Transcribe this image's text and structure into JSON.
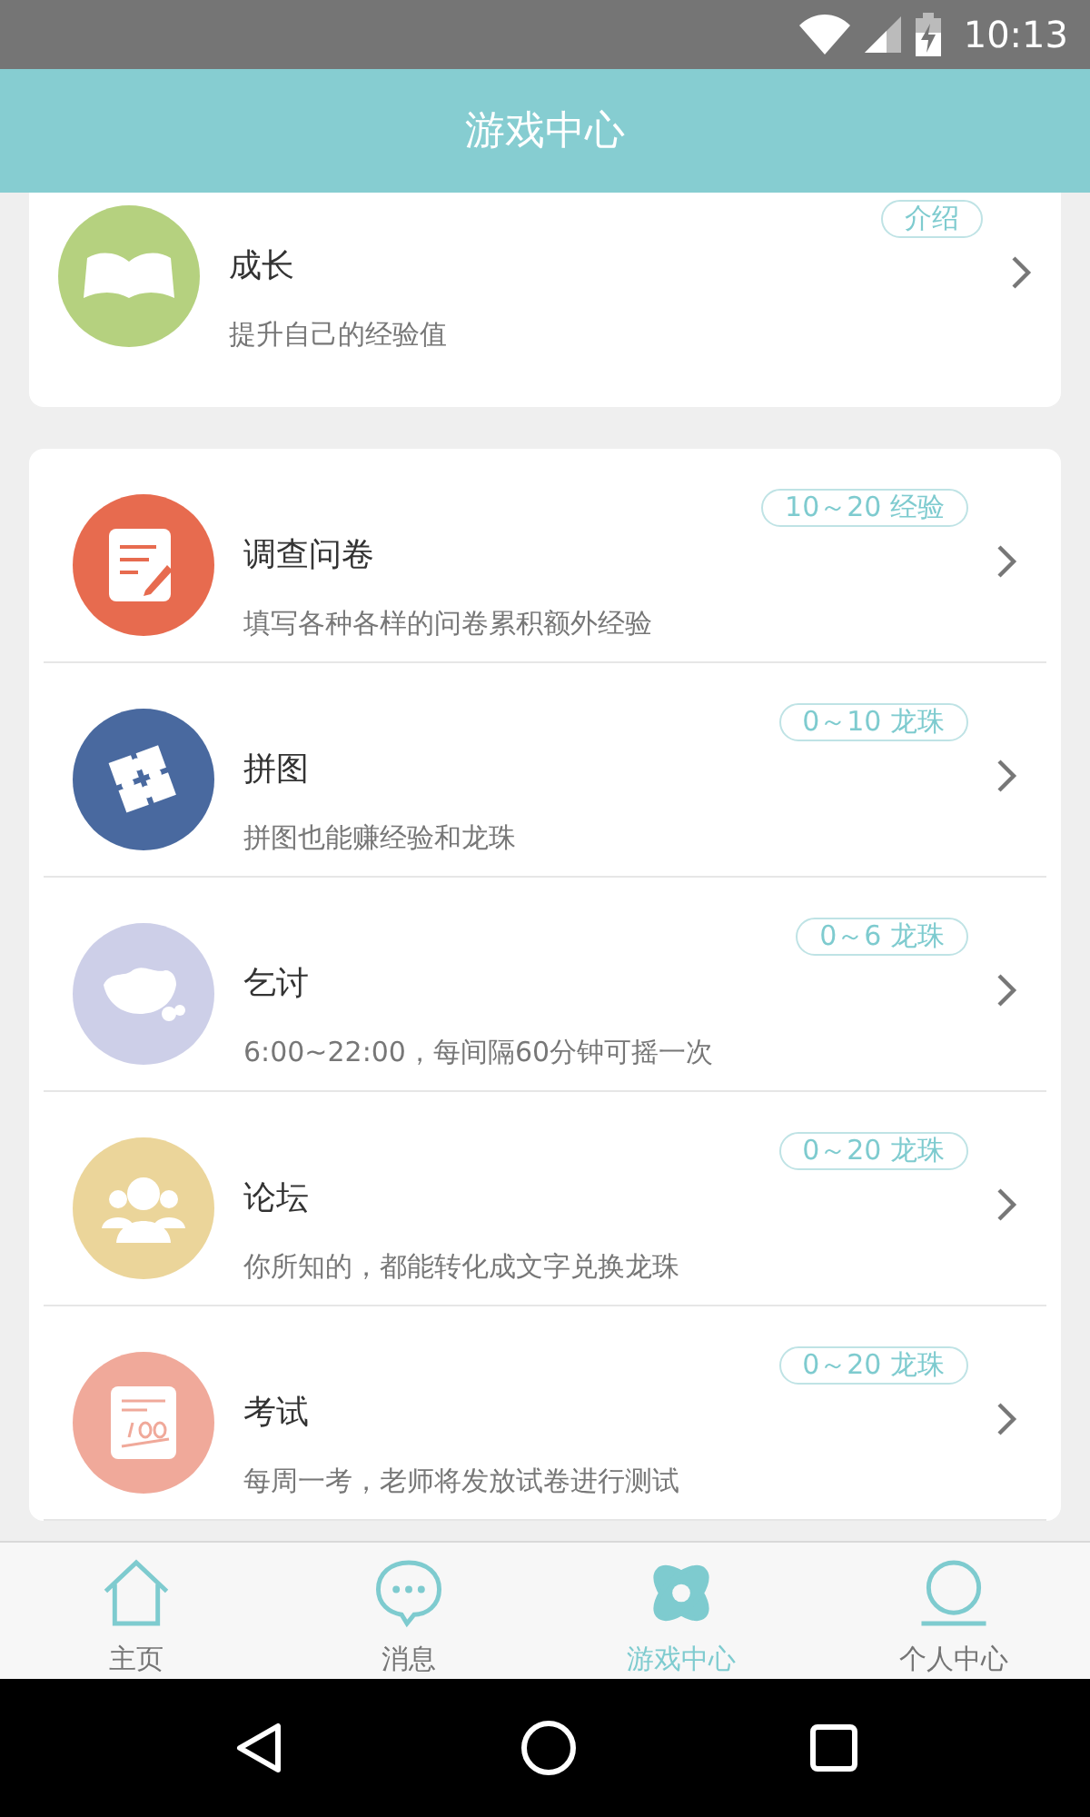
{
  "status_bar": {
    "time": "10:13"
  },
  "header": {
    "title": "游戏中心"
  },
  "cards": [
    {
      "items": [
        {
          "title": "成长",
          "description": "提升自己的经验值",
          "badge": "介绍",
          "color": "#b5d17f"
        }
      ]
    },
    {
      "items": [
        {
          "title": "调查问卷",
          "description": "填写各种各样的问卷累积额外经验",
          "badge": "10～20 经验",
          "color": "#e76b4f"
        },
        {
          "title": "拼图",
          "description": "拼图也能赚经验和龙珠",
          "badge": "0～10 龙珠",
          "color": "#49699f"
        },
        {
          "title": "乞讨",
          "description": "6:00~22:00，每间隔60分钟可摇一次",
          "badge": "0～6 龙珠",
          "color": "#cdcfe8"
        },
        {
          "title": "论坛",
          "description": "你所知的，都能转化成文字兑换龙珠",
          "badge": "0～20 龙珠",
          "color": "#ebd59a"
        },
        {
          "title": "考试",
          "description": "每周一考，老师将发放试卷进行测试",
          "badge": "0～20 龙珠",
          "color": "#f0a99a"
        }
      ]
    }
  ],
  "tab_bar": [
    {
      "label": "主页",
      "selected": false
    },
    {
      "label": "消息",
      "selected": false
    },
    {
      "label": "游戏中心",
      "selected": true
    },
    {
      "label": "个人中心",
      "selected": false
    }
  ]
}
